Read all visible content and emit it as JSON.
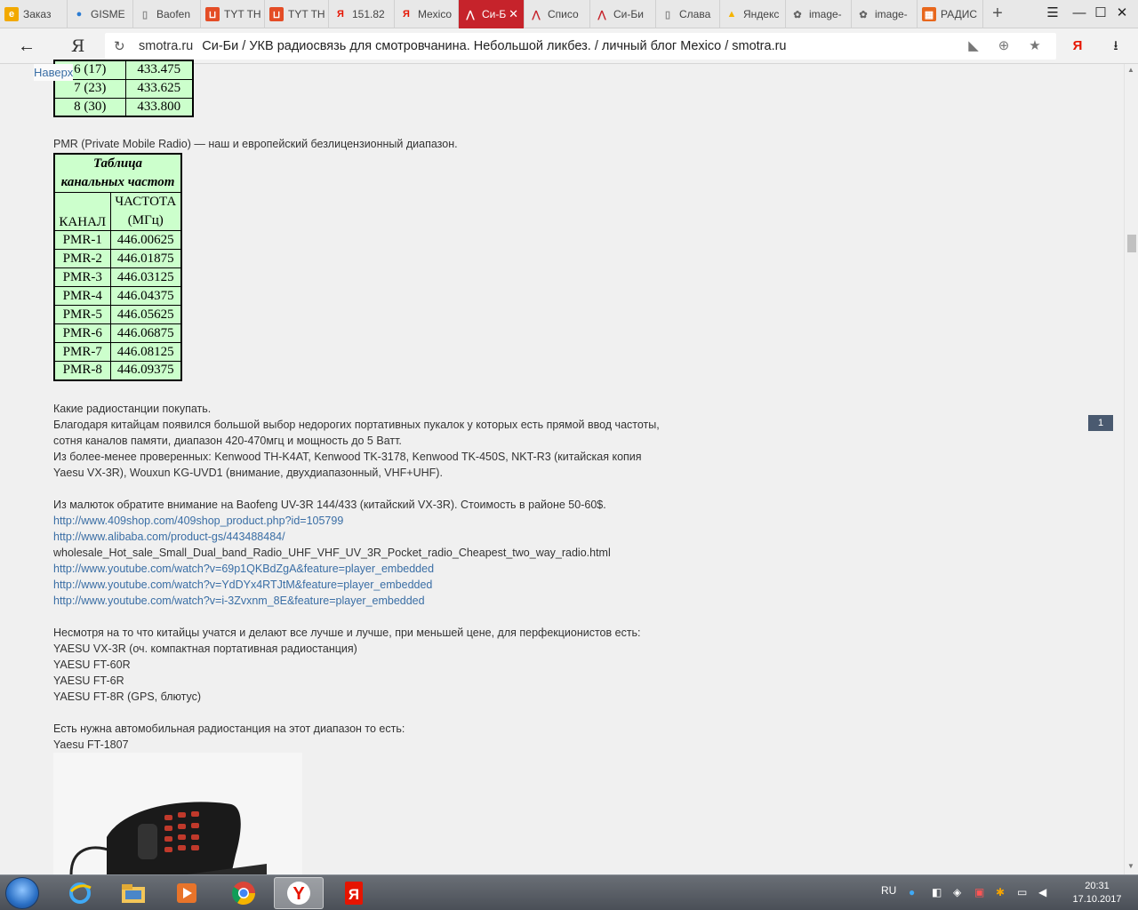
{
  "browser": {
    "tabs": [
      {
        "label": "Заказ",
        "icon": "e-shop-icon",
        "color": "#f2a900"
      },
      {
        "label": "GISME",
        "icon": "drop-icon",
        "color": "#2b7cd3"
      },
      {
        "label": "Baofen",
        "icon": "page-icon",
        "color": "#888888"
      },
      {
        "label": "TYT TH",
        "icon": "shopping-bag-icon",
        "color": "#e44d26"
      },
      {
        "label": "TYT TH",
        "icon": "shopping-bag-icon",
        "color": "#e44d26"
      },
      {
        "label": "151.82",
        "icon": "yandex-icon",
        "color": "#e61400"
      },
      {
        "label": "Mexico",
        "icon": "yandex-icon",
        "color": "#e61400"
      },
      {
        "label": "Си-Б",
        "icon": "smotra-icon",
        "color": "#ffffff"
      },
      {
        "label": "Списо",
        "icon": "smotra-icon",
        "color": "#c6232b"
      },
      {
        "label": "Си-Би",
        "icon": "smotra-icon",
        "color": "#c6232b"
      },
      {
        "label": "Слава",
        "icon": "page-icon",
        "color": "#888888"
      },
      {
        "label": "Яндекс",
        "icon": "images-icon",
        "color": "#f5b400"
      },
      {
        "label": "image-",
        "icon": "globe-icon",
        "color": "#666666"
      },
      {
        "label": "image-",
        "icon": "globe-icon",
        "color": "#666666"
      },
      {
        "label": "РАДИС",
        "icon": "box-icon",
        "color": "#e8671c"
      }
    ],
    "active_tab_index": 7,
    "address": {
      "domain": "smotra.ru",
      "title": "Си-Би / УКВ радиосвязь для смотровчанина. Небольшой ликбез. / личный блог Mexico / smotra.ru"
    },
    "yandex_letter": "Я"
  },
  "page": {
    "up_link": "Наверх",
    "page_badge": "1",
    "table1_rows": [
      {
        "ch": "6 (17)",
        "freq": "433.475"
      },
      {
        "ch": "7 (23)",
        "freq": "433.625"
      },
      {
        "ch": "8 (30)",
        "freq": "433.800"
      }
    ],
    "pmr_intro": "PMR (Private Mobile Radio) — наш и европейский безлицензионный диапазон.",
    "pmr_table": {
      "title_line1": "Таблица",
      "title_line2": "канальных частот",
      "col1": "КАНАЛ",
      "col2_line1": "ЧАСТОТА",
      "col2_line2": "(МГц)",
      "rows": [
        {
          "ch": "PMR-1",
          "freq": "446.00625"
        },
        {
          "ch": "PMR-2",
          "freq": "446.01875"
        },
        {
          "ch": "PMR-3",
          "freq": "446.03125"
        },
        {
          "ch": "PMR-4",
          "freq": "446.04375"
        },
        {
          "ch": "PMR-5",
          "freq": "446.05625"
        },
        {
          "ch": "PMR-6",
          "freq": "446.06875"
        },
        {
          "ch": "PMR-7",
          "freq": "446.08125"
        },
        {
          "ch": "PMR-8",
          "freq": "446.09375"
        }
      ]
    },
    "para1": [
      "Какие радиостанции покупать.",
      "Благодаря китайцам появился большой выбор недорогих портативных пукалок у которых есть прямой ввод частоты,",
      "сотня каналов памяти, диапазон 420-470мгц и мощность до 5 Ватт.",
      "Из более-менее проверенных: Kenwood TH-K4AT, Kenwood TK-3178, Kenwood TK-450S, NKT-R3 (китайская копия",
      "Yaesu VX-3R), Wouxun KG-UVD1 (внимание, двухдиапазонный, VHF+UHF)."
    ],
    "baofeng_line": "Из малюток обратите внимание на Baofeng UV-3R 144/433 (китайский VX-3R). Стоимость в районе 50-60$.",
    "links": {
      "l1": "http://www.409shop.com/409shop_product.php?id=105799",
      "l2": "http://www.alibaba.com/product-gs/443488484/",
      "l2_cont": "wholesale_Hot_sale_Small_Dual_band_Radio_UHF_VHF_UV_3R_Pocket_radio_Cheapest_two_way_radio.html",
      "l3": "http://www.youtube.com/watch?v=69p1QKBdZgA&feature=player_embedded",
      "l4": "http://www.youtube.com/watch?v=YdDYx4RTJtM&feature=player_embedded",
      "l5": "http://www.youtube.com/watch?v=i-3Zvxnm_8E&feature=player_embedded"
    },
    "para2": [
      "Несмотря на то что китайцы учатся и делают все лучше и лучше, при меньшей цене, для перфекционистов есть:",
      "YAESU VX-3R (оч. компактная портативная радиостанция)",
      "YAESU FT-60R",
      "YAESU FT-6R",
      "YAESU FT-8R (GPS, блютус)"
    ],
    "para3": [
      "Есть нужна автомобильная радиостанция на этот диапазон то есть:",
      "Yaesu FT-1807"
    ]
  },
  "taskbar": {
    "apps": [
      "ie-icon",
      "file-explorer-icon",
      "media-player-icon",
      "chrome-icon",
      "yandex-browser-icon",
      "yandex-browser-icon"
    ],
    "active_app_index": 4,
    "lang": "RU",
    "time": "20:31",
    "date": "17.10.2017"
  }
}
